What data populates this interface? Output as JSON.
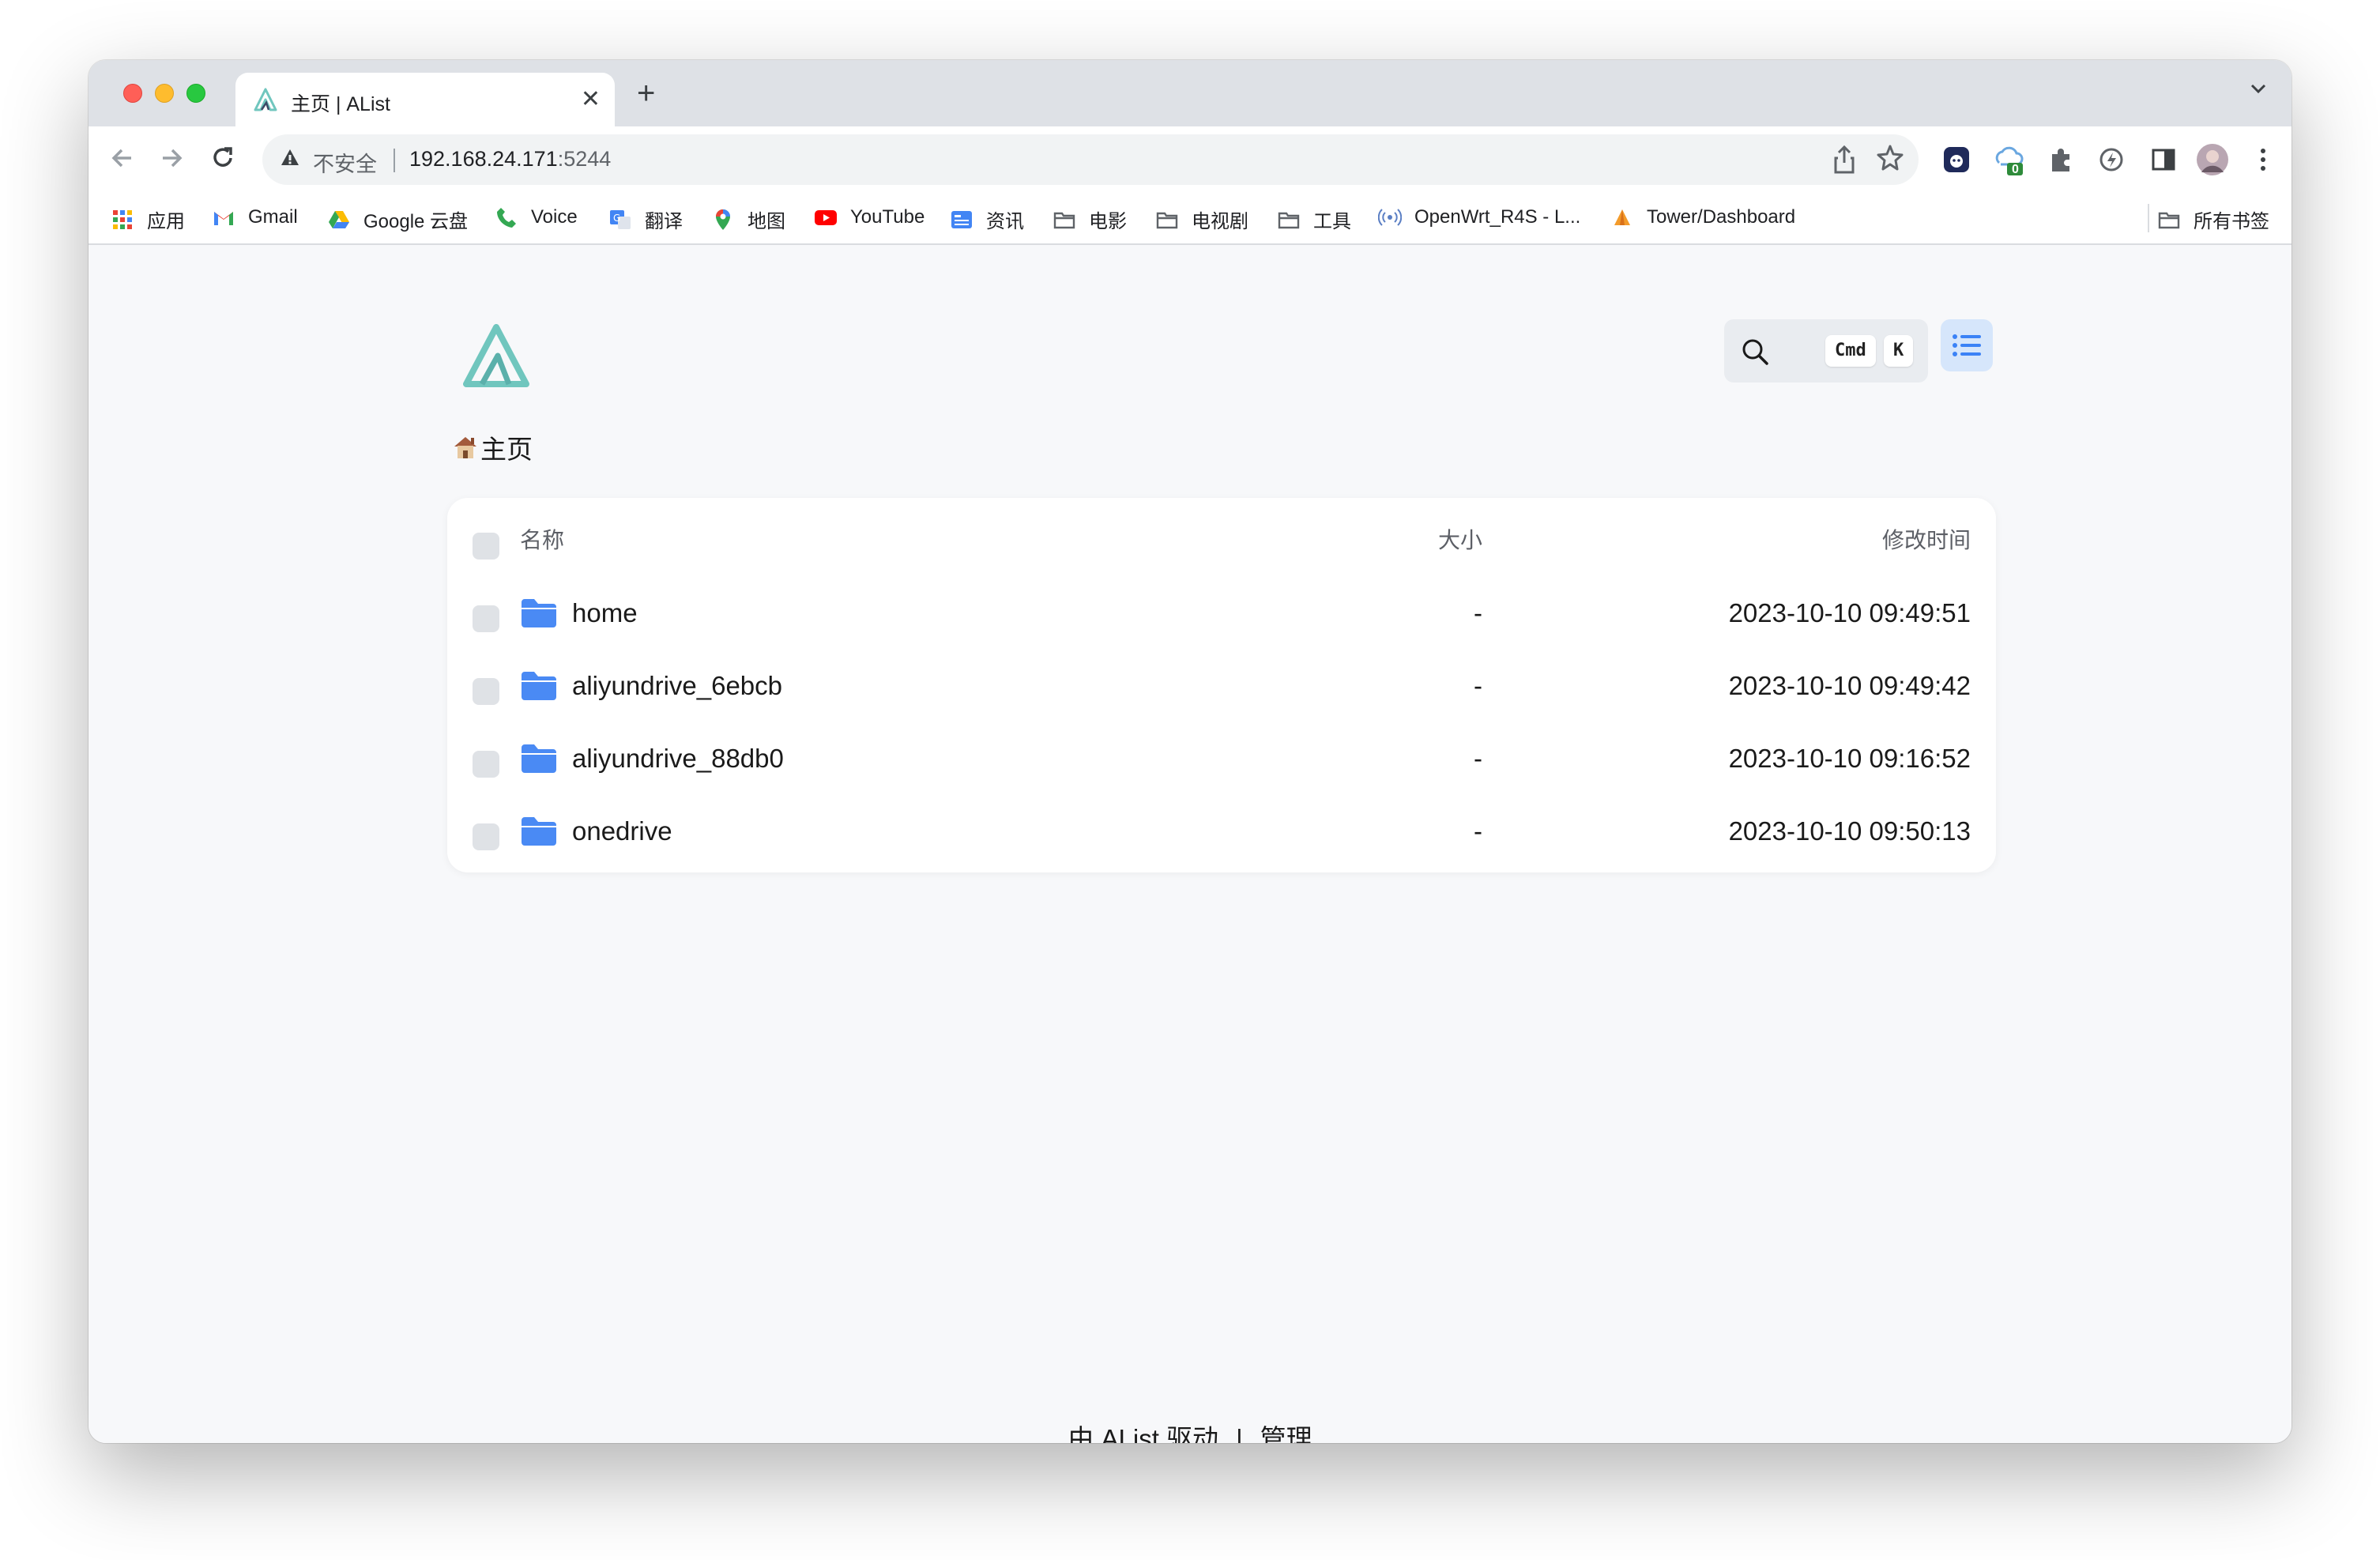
{
  "browser": {
    "tab_title": "主页 | AList",
    "tab_close": "✕",
    "new_tab": "+",
    "url_warning": "不安全",
    "url_host": "192.168.24.171",
    "url_port": ":5244",
    "extension_badge": "0"
  },
  "bookmarks": [
    {
      "label": "应用",
      "icon": "apps-grid-icon"
    },
    {
      "label": "Gmail",
      "icon": "gmail-icon"
    },
    {
      "label": "Google 云盘",
      "icon": "google-drive-icon"
    },
    {
      "label": "Voice",
      "icon": "phone-icon"
    },
    {
      "label": "翻译",
      "icon": "translate-icon"
    },
    {
      "label": "地图",
      "icon": "maps-pin-icon"
    },
    {
      "label": "YouTube",
      "icon": "youtube-icon"
    },
    {
      "label": "资讯",
      "icon": "news-icon"
    },
    {
      "label": "电影",
      "icon": "folder-icon"
    },
    {
      "label": "电视剧",
      "icon": "folder-icon"
    },
    {
      "label": "工具",
      "icon": "folder-icon"
    },
    {
      "label": "OpenWrt_R4S - L...",
      "icon": "wireless-icon"
    },
    {
      "label": "Tower/Dashboard",
      "icon": "tower-icon"
    }
  ],
  "bookmarks_all": "所有书签",
  "search": {
    "key_cmd": "Cmd",
    "key_k": "K"
  },
  "breadcrumb": {
    "label": "主页"
  },
  "table": {
    "headers": {
      "name": "名称",
      "size": "大小",
      "modified": "修改时间"
    },
    "rows": [
      {
        "name": "home",
        "size": "-",
        "modified": "2023-10-10 09:49:51"
      },
      {
        "name": "aliyundrive_6ebcb",
        "size": "-",
        "modified": "2023-10-10 09:49:42"
      },
      {
        "name": "aliyundrive_88db0",
        "size": "-",
        "modified": "2023-10-10 09:16:52"
      },
      {
        "name": "onedrive",
        "size": "-",
        "modified": "2023-10-10 09:50:13"
      }
    ]
  },
  "footer": {
    "powered": "由 AList 驱动",
    "separator": "|",
    "manage": "管理"
  },
  "side_tools": [
    "refresh-icon",
    "new-file-icon",
    "new-folder-icon",
    "sort-upload-icon",
    "remove-folder-icon",
    "local-settings-icon",
    "upload-cloud-icon",
    "link-icon",
    "select-icon",
    "settings-icon",
    "more-icon"
  ],
  "colors": {
    "accent": "#3b82f6",
    "folder": "#4a8af4",
    "logo": "#70c6be",
    "page_bg": "#f7f8fa"
  }
}
